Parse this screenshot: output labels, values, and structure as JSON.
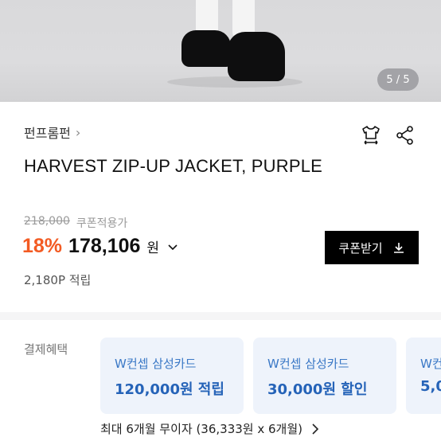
{
  "photo": {
    "counter": "5 / 5"
  },
  "brand": {
    "name": "펀프롬펀",
    "chevron": "›"
  },
  "icons": {
    "shirt": "tshirt-size-icon",
    "share": "share-icon"
  },
  "product": {
    "title": "HARVEST ZIP-UP JACKET, PURPLE"
  },
  "price": {
    "original": "218,000",
    "coupon_label": "쿠폰적용가",
    "discount": "18%",
    "final": "178,106",
    "currency": "원",
    "points": "2,180P 적립"
  },
  "coupon_button": {
    "label": "쿠폰받기"
  },
  "payment": {
    "label": "결제혜택",
    "cards": [
      {
        "name": "W컨셉 삼성카드",
        "benefit": "120,000원 적립"
      },
      {
        "name": "W컨셉 삼성카드",
        "benefit": "30,000원 할인"
      },
      {
        "name": "W컨",
        "benefit": "5,0"
      }
    ],
    "installment": "최대 6개월 무이자 (36,333원 x 6개월)"
  },
  "colors": {
    "discount": "#f35b23",
    "card_bg": "#eef3fb",
    "card_text": "#2563b8",
    "button": "#000000"
  }
}
